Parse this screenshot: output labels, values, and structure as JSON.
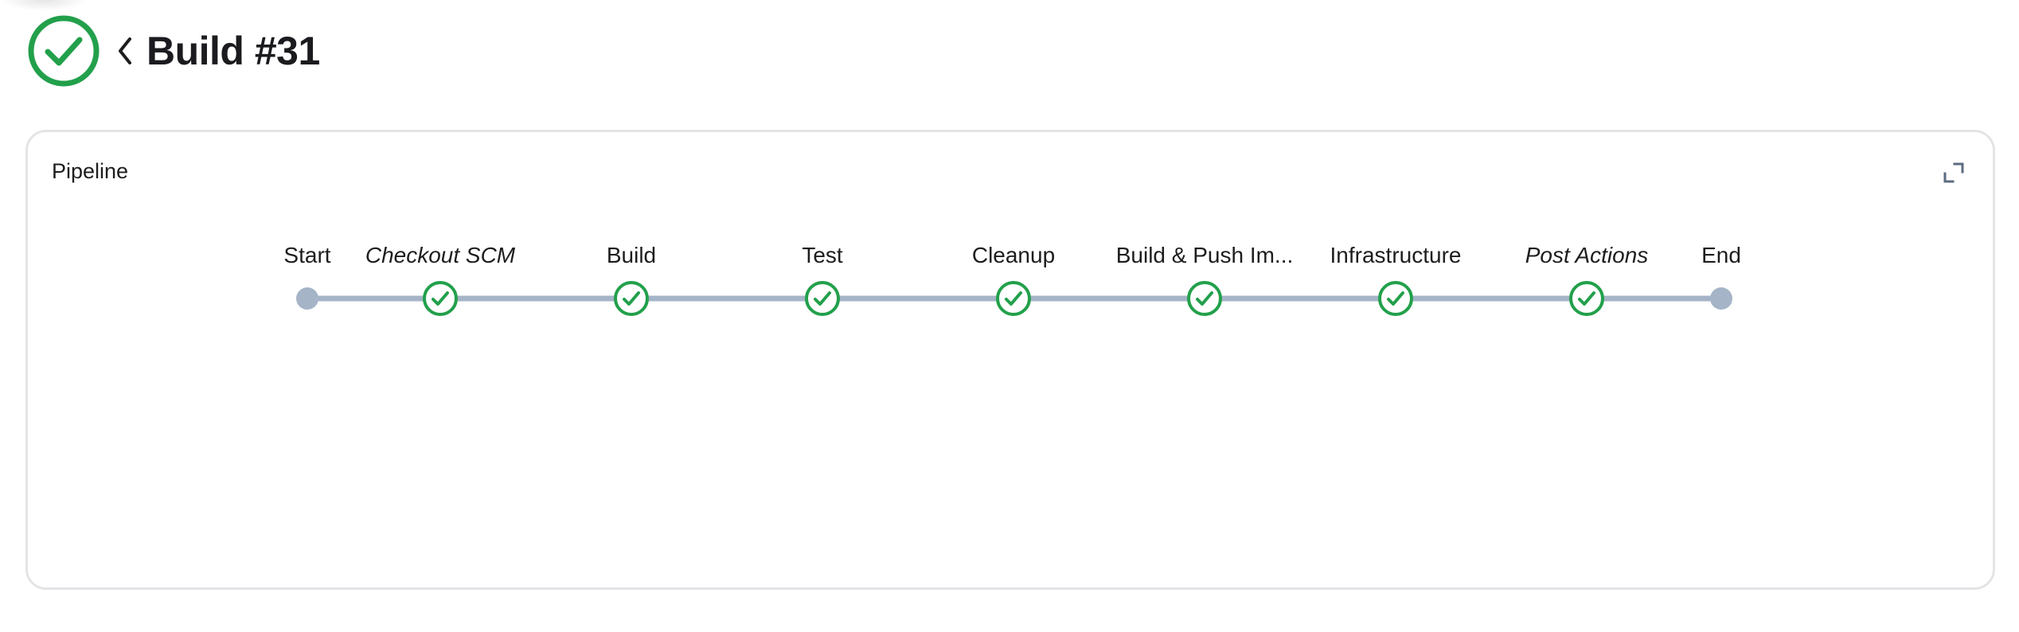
{
  "header": {
    "status_icon": "check-circle-icon",
    "back_icon": "chevron-left-icon",
    "title": "Build #31"
  },
  "card": {
    "title": "Pipeline",
    "expand_icon": "expand-icon"
  },
  "colors": {
    "success": "#22a04b",
    "connector": "#a5b4c7",
    "endpoint": "#a5b4c7",
    "border": "#e4e4e7",
    "text": "#1d1d1f"
  },
  "pipeline": {
    "stages": [
      {
        "label": "Start",
        "kind": "endpoint",
        "italic": false
      },
      {
        "label": "Checkout SCM",
        "kind": "success",
        "italic": true
      },
      {
        "label": "Build",
        "kind": "success",
        "italic": false
      },
      {
        "label": "Test",
        "kind": "success",
        "italic": false
      },
      {
        "label": "Cleanup",
        "kind": "success",
        "italic": false
      },
      {
        "label": "Build & Push Im...",
        "kind": "success",
        "italic": false
      },
      {
        "label": "Infrastructure",
        "kind": "success",
        "italic": false
      },
      {
        "label": "Post Actions",
        "kind": "success",
        "italic": true
      },
      {
        "label": "End",
        "kind": "endpoint",
        "italic": false
      }
    ]
  }
}
